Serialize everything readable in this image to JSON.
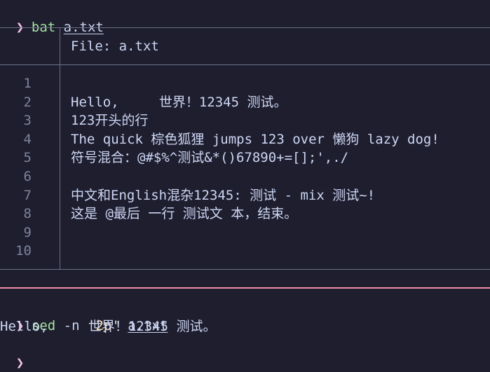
{
  "prompt_symbol": "❯",
  "command1": {
    "program": "bat",
    "arg": "a.txt"
  },
  "bat_header": {
    "label": "File: ",
    "filename": "a.txt"
  },
  "file_lines": [
    {
      "num": "1",
      "text": ""
    },
    {
      "num": "2",
      "text": "Hello,     世界！12345 测试。"
    },
    {
      "num": "3",
      "text": "123开头的行"
    },
    {
      "num": "4",
      "text": "The quick 棕色狐狸 jumps 123 over 懒狗 lazy dog!"
    },
    {
      "num": "5",
      "text": "符号混合：@#$%^测试&*()67890+=[];',./"
    },
    {
      "num": "6",
      "text": ""
    },
    {
      "num": "7",
      "text": "中文和English混杂12345: 测试 - mix 测试~!"
    },
    {
      "num": "8",
      "text": "这是 @最后 一行 测试文 本，结束。"
    },
    {
      "num": "9",
      "text": ""
    },
    {
      "num": "10",
      "text": ""
    }
  ],
  "command2": {
    "program": "sed",
    "flag": "-n",
    "script": "'2p'",
    "arg": "a.txt"
  },
  "output2": "Hello,     世界！12345 测试。",
  "colors": {
    "background": "#1e1e2e",
    "prompt": "#f5c2e7",
    "command": "#a6e3a1",
    "string": "#f9e2af",
    "separator": "#f38ba8",
    "border": "#6c7086",
    "line_number": "#7f849c",
    "text": "#cdd6f4"
  }
}
